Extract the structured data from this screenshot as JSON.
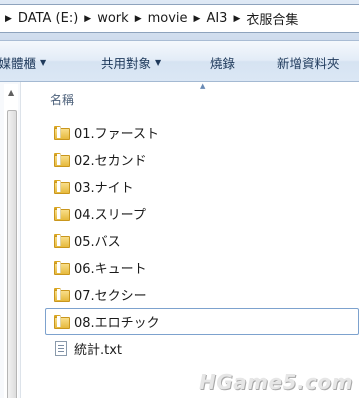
{
  "breadcrumb": [
    {
      "label": "DATA (E:)"
    },
    {
      "label": "work"
    },
    {
      "label": "movie"
    },
    {
      "label": "AI3"
    },
    {
      "label": "衣服合集"
    }
  ],
  "toolbar": {
    "items": [
      {
        "label": "至媒體櫃",
        "has_dropdown": true
      },
      {
        "label": "共用對象",
        "has_dropdown": true
      },
      {
        "label": "燒錄",
        "has_dropdown": false
      },
      {
        "label": "新增資料夾",
        "has_dropdown": false
      }
    ]
  },
  "columns": {
    "name_header": "名稱"
  },
  "files": [
    {
      "name": "01.ファースト",
      "type": "folder"
    },
    {
      "name": "02.セカンド",
      "type": "folder"
    },
    {
      "name": "03.ナイト",
      "type": "folder"
    },
    {
      "name": "04.スリープ",
      "type": "folder"
    },
    {
      "name": "05.バス",
      "type": "folder"
    },
    {
      "name": "06.キュート",
      "type": "folder"
    },
    {
      "name": "07.セクシー",
      "type": "folder"
    },
    {
      "name": "08.エロチック",
      "type": "folder",
      "focused": true
    },
    {
      "name": "統計.txt",
      "type": "text-file"
    }
  ],
  "watermark": "HGame5.com",
  "colors": {
    "folder": "#e6b93c",
    "toolbar_text": "#1e395b",
    "focus_border": "#7da2ce"
  }
}
